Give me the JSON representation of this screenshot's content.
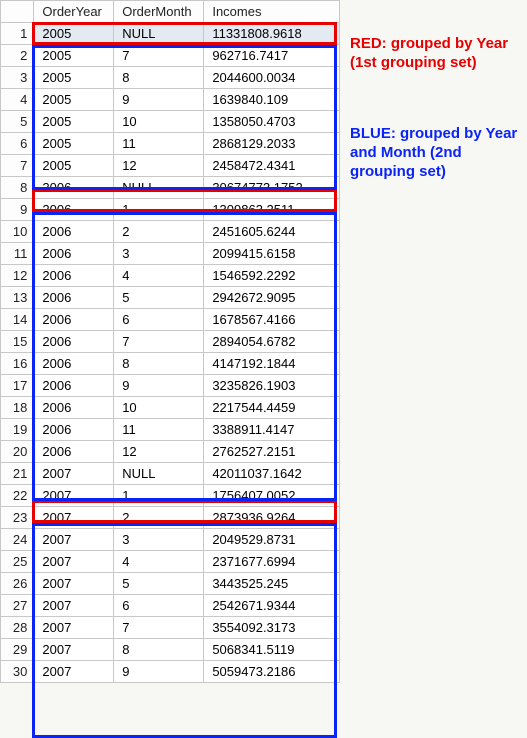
{
  "headers": {
    "rownum": "",
    "year": "OrderYear",
    "month": "OrderMonth",
    "income": "Incomes"
  },
  "rows": [
    {
      "n": "1",
      "year": "2005",
      "month": "NULL",
      "income": "11331808.9618",
      "sel": true
    },
    {
      "n": "2",
      "year": "2005",
      "month": "7",
      "income": "962716.7417"
    },
    {
      "n": "3",
      "year": "2005",
      "month": "8",
      "income": "2044600.0034"
    },
    {
      "n": "4",
      "year": "2005",
      "month": "9",
      "income": "1639840.109"
    },
    {
      "n": "5",
      "year": "2005",
      "month": "10",
      "income": "1358050.4703"
    },
    {
      "n": "6",
      "year": "2005",
      "month": "11",
      "income": "2868129.2033"
    },
    {
      "n": "7",
      "year": "2005",
      "month": "12",
      "income": "2458472.4341"
    },
    {
      "n": "8",
      "year": "2006",
      "month": "NULL",
      "income": "30674773.1752"
    },
    {
      "n": "9",
      "year": "2006",
      "month": "1",
      "income": "1309863.2511"
    },
    {
      "n": "10",
      "year": "2006",
      "month": "2",
      "income": "2451605.6244"
    },
    {
      "n": "11",
      "year": "2006",
      "month": "3",
      "income": "2099415.6158"
    },
    {
      "n": "12",
      "year": "2006",
      "month": "4",
      "income": "1546592.2292"
    },
    {
      "n": "13",
      "year": "2006",
      "month": "5",
      "income": "2942672.9095"
    },
    {
      "n": "14",
      "year": "2006",
      "month": "6",
      "income": "1678567.4166"
    },
    {
      "n": "15",
      "year": "2006",
      "month": "7",
      "income": "2894054.6782"
    },
    {
      "n": "16",
      "year": "2006",
      "month": "8",
      "income": "4147192.1844"
    },
    {
      "n": "17",
      "year": "2006",
      "month": "9",
      "income": "3235826.1903"
    },
    {
      "n": "18",
      "year": "2006",
      "month": "10",
      "income": "2217544.4459"
    },
    {
      "n": "19",
      "year": "2006",
      "month": "11",
      "income": "3388911.4147"
    },
    {
      "n": "20",
      "year": "2006",
      "month": "12",
      "income": "2762527.2151"
    },
    {
      "n": "21",
      "year": "2007",
      "month": "NULL",
      "income": "42011037.1642"
    },
    {
      "n": "22",
      "year": "2007",
      "month": "1",
      "income": "1756407.0052"
    },
    {
      "n": "23",
      "year": "2007",
      "month": "2",
      "income": "2873936.9264"
    },
    {
      "n": "24",
      "year": "2007",
      "month": "3",
      "income": "2049529.8731"
    },
    {
      "n": "25",
      "year": "2007",
      "month": "4",
      "income": "2371677.6994"
    },
    {
      "n": "26",
      "year": "2007",
      "month": "5",
      "income": "3443525.245"
    },
    {
      "n": "27",
      "year": "2007",
      "month": "6",
      "income": "2542671.9344"
    },
    {
      "n": "28",
      "year": "2007",
      "month": "7",
      "income": "3554092.3173"
    },
    {
      "n": "29",
      "year": "2007",
      "month": "8",
      "income": "5068341.5119"
    },
    {
      "n": "30",
      "year": "2007",
      "month": "9",
      "income": "5059473.2186"
    }
  ],
  "annotations": {
    "red": "RED: grouped by Year (1st grouping set)",
    "blue": "BLUE: grouped by Year and Month (2nd grouping set)"
  },
  "chart_data": {
    "type": "table",
    "columns": [
      "OrderYear",
      "OrderMonth",
      "Incomes"
    ],
    "grouping_sets": [
      {
        "name": "by Year",
        "color": "red",
        "row_indices_1based": [
          1,
          8,
          21
        ]
      },
      {
        "name": "by Year and Month",
        "color": "blue",
        "row_indices_1based": [
          2,
          3,
          4,
          5,
          6,
          7,
          9,
          10,
          11,
          12,
          13,
          14,
          15,
          16,
          17,
          18,
          19,
          20,
          22,
          23,
          24,
          25,
          26,
          27,
          28,
          29,
          30
        ]
      }
    ]
  }
}
